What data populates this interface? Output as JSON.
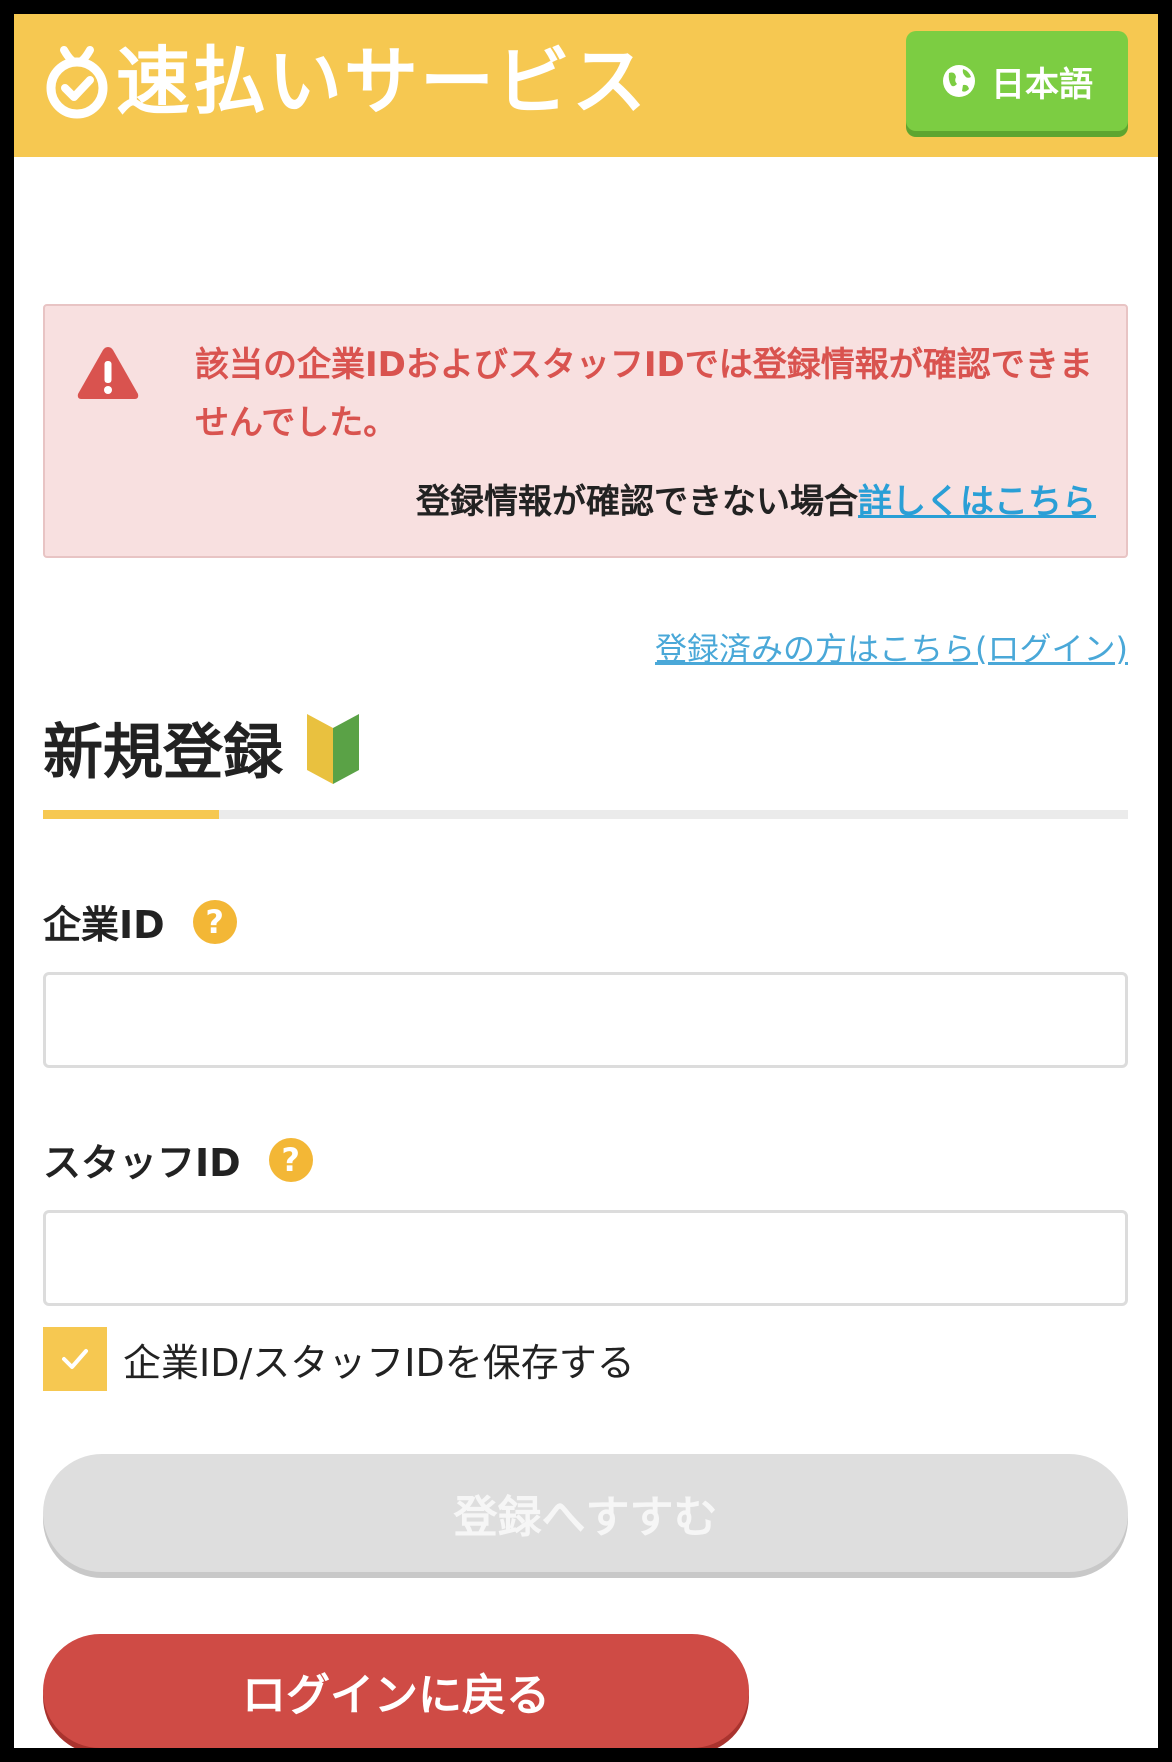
{
  "header": {
    "service_name": "速払いサービス",
    "language_label": "日本語",
    "background_color": "#f6c851"
  },
  "alert": {
    "message": "該当の企業IDおよびスタッフIDでは登録情報が確認できませんでした。",
    "help_prefix": "登録情報が確認できない場合",
    "help_link": "詳しくはこちら"
  },
  "login_link": "登録済みの方はこちら(ログイン)",
  "section": {
    "title": "新規登録"
  },
  "form": {
    "company_id_label": "企業ID",
    "company_id_value": "",
    "staff_id_label": "スタッフID",
    "staff_id_value": "",
    "help_mark": "?",
    "save_label": "企業ID/スタッフIDを保存する",
    "save_checked": true
  },
  "buttons": {
    "next_label": "登録へすすむ",
    "back_label": "ログインに戻る"
  },
  "colors": {
    "accent": "#f6c851",
    "error": "#d9534f",
    "link": "#2a9fd6",
    "back_button": "#cf4b45",
    "language_button": "#7ccd42"
  }
}
